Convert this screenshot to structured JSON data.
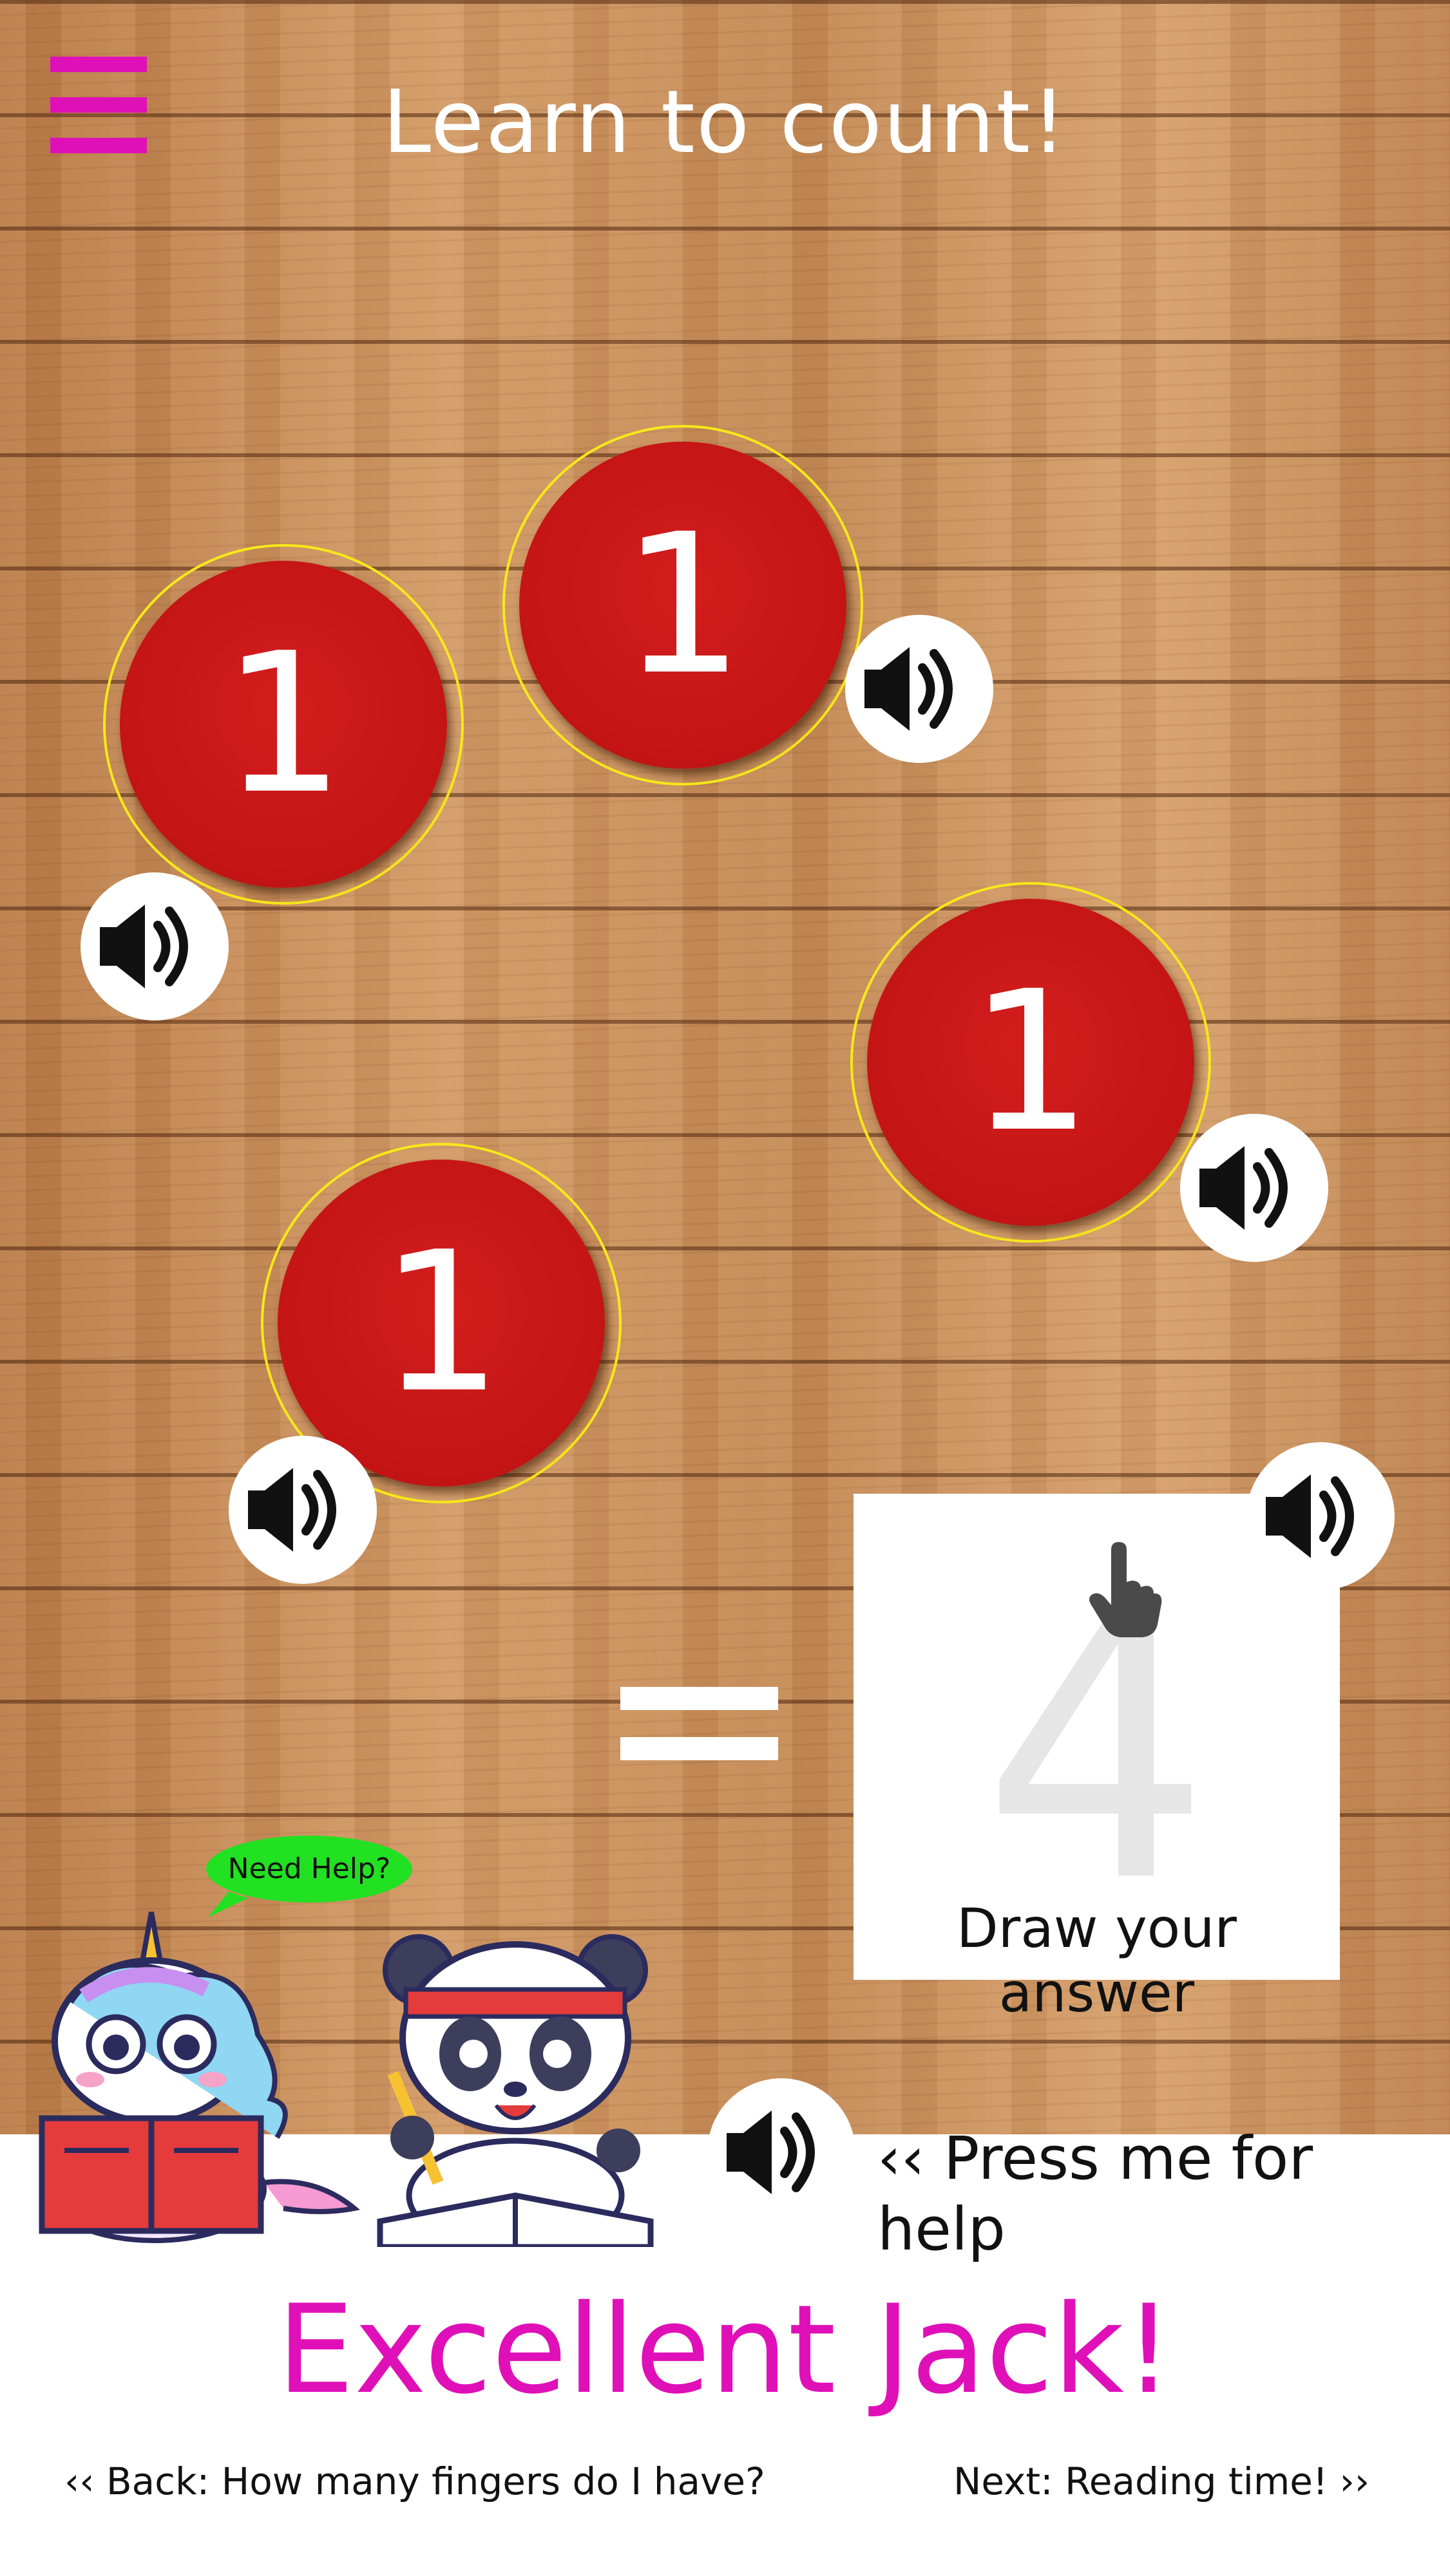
{
  "app": {
    "title": "Learn to count!"
  },
  "colors": {
    "accent": "#e010b8",
    "coin": "#c41414",
    "ring": "#f7e81a",
    "wood": "#c48a57"
  },
  "icons": {
    "menu": "hamburger-menu-icon",
    "speaker": "speaker-icon",
    "pointer": "hand-pointer-icon"
  },
  "coins": [
    {
      "label": "1"
    },
    {
      "label": "1"
    },
    {
      "label": "1"
    },
    {
      "label": "1"
    }
  ],
  "answer": {
    "ghost_value": "4",
    "label": "Draw your answer"
  },
  "help": {
    "bubble": "Need Help?",
    "prompt": "‹‹ Press me for help"
  },
  "feedback": {
    "message": "Excellent Jack!"
  },
  "navigation": {
    "back": "‹‹ Back: How many fingers do I have?",
    "next": "Next: Reading time! ››"
  }
}
